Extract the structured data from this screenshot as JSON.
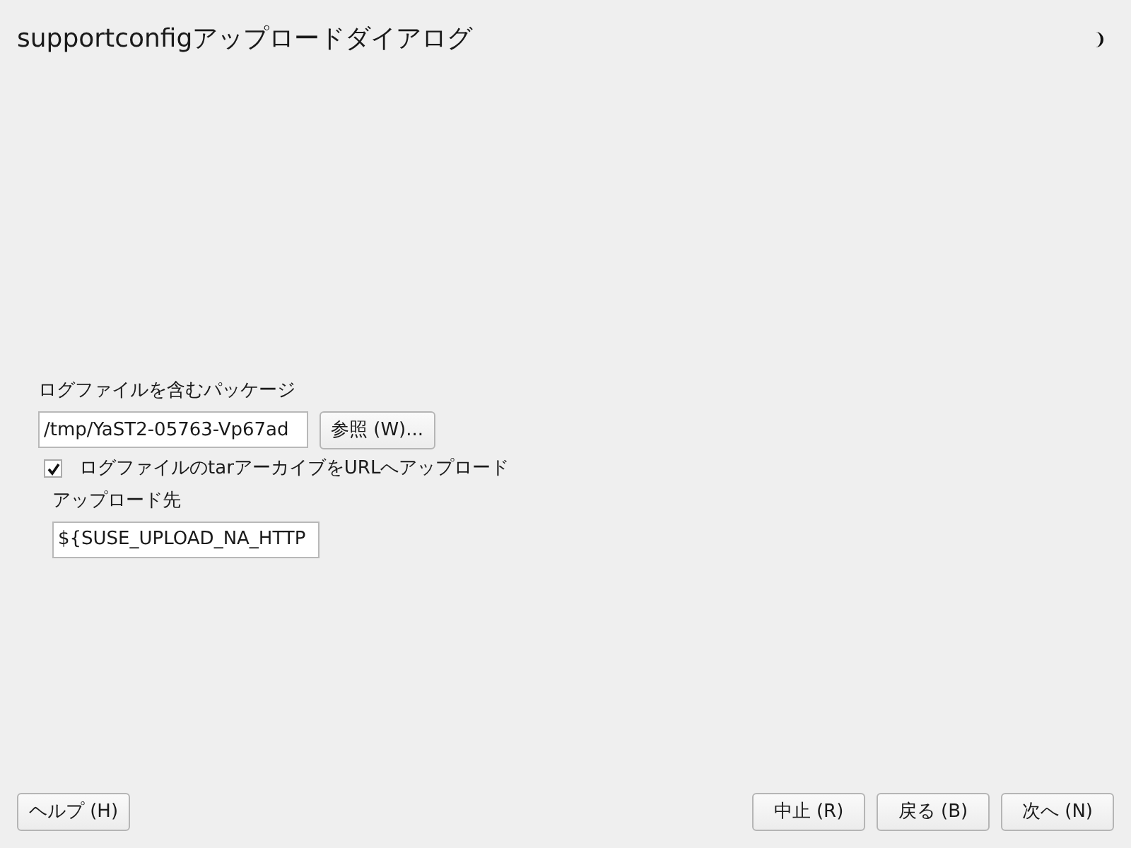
{
  "window": {
    "title": "supportconfigアップロードダイアログ"
  },
  "form": {
    "package_label": "ログファイルを含むパッケージ",
    "package_value": "/tmp/YaST2-05763-Vp67ad",
    "browse_button": "参照 (W)...",
    "upload_checkbox": {
      "label": "ログファイルのtarアーカイブをURLへアップロード",
      "checked": true
    },
    "destination_label": "アップロード先",
    "destination_value": "${SUSE_UPLOAD_NA_HTTP"
  },
  "buttons": [
    {
      "label": "ヘルプ (H)",
      "kind": "left"
    },
    {
      "label": "中止 (R)",
      "kind": "right"
    },
    {
      "label": "戻る (B)",
      "kind": "right"
    },
    {
      "label": "次へ (N)",
      "kind": "right"
    }
  ]
}
